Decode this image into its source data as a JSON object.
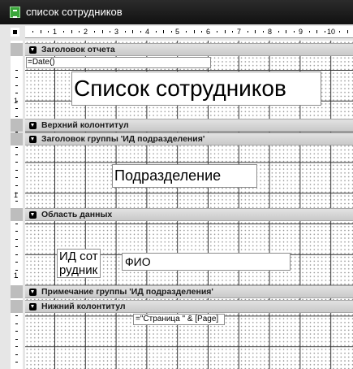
{
  "window": {
    "title": "список сотрудников"
  },
  "ruler": {
    "horizontal_marks": [
      "1",
      "2",
      "3",
      "4",
      "5",
      "6",
      "7",
      "8",
      "9",
      "10"
    ],
    "vertical_marks": [
      "1",
      "1",
      "1"
    ]
  },
  "sections": {
    "report_header": "Заголовок отчета",
    "page_header": "Верхний колонтитул",
    "group_header": "Заголовок группы 'ИД подразделения'",
    "detail": "Область данных",
    "group_footer": "Примечание группы 'ИД подразделения'",
    "page_footer": "Нижний колонтитул"
  },
  "controls": {
    "date_field": "=Date()",
    "report_title": "Список сотрудников",
    "department_label": "Подразделение",
    "employee_id_field": "ИД сотрудника",
    "full_name_field": "ФИО",
    "page_number_field": "=\"Страница \" & [Page]"
  },
  "colors": {
    "title_bar": "#1f1f1f",
    "band_header": "#d4d4d4",
    "grid_background": "#ffffff",
    "grid_lines": "#333333"
  }
}
